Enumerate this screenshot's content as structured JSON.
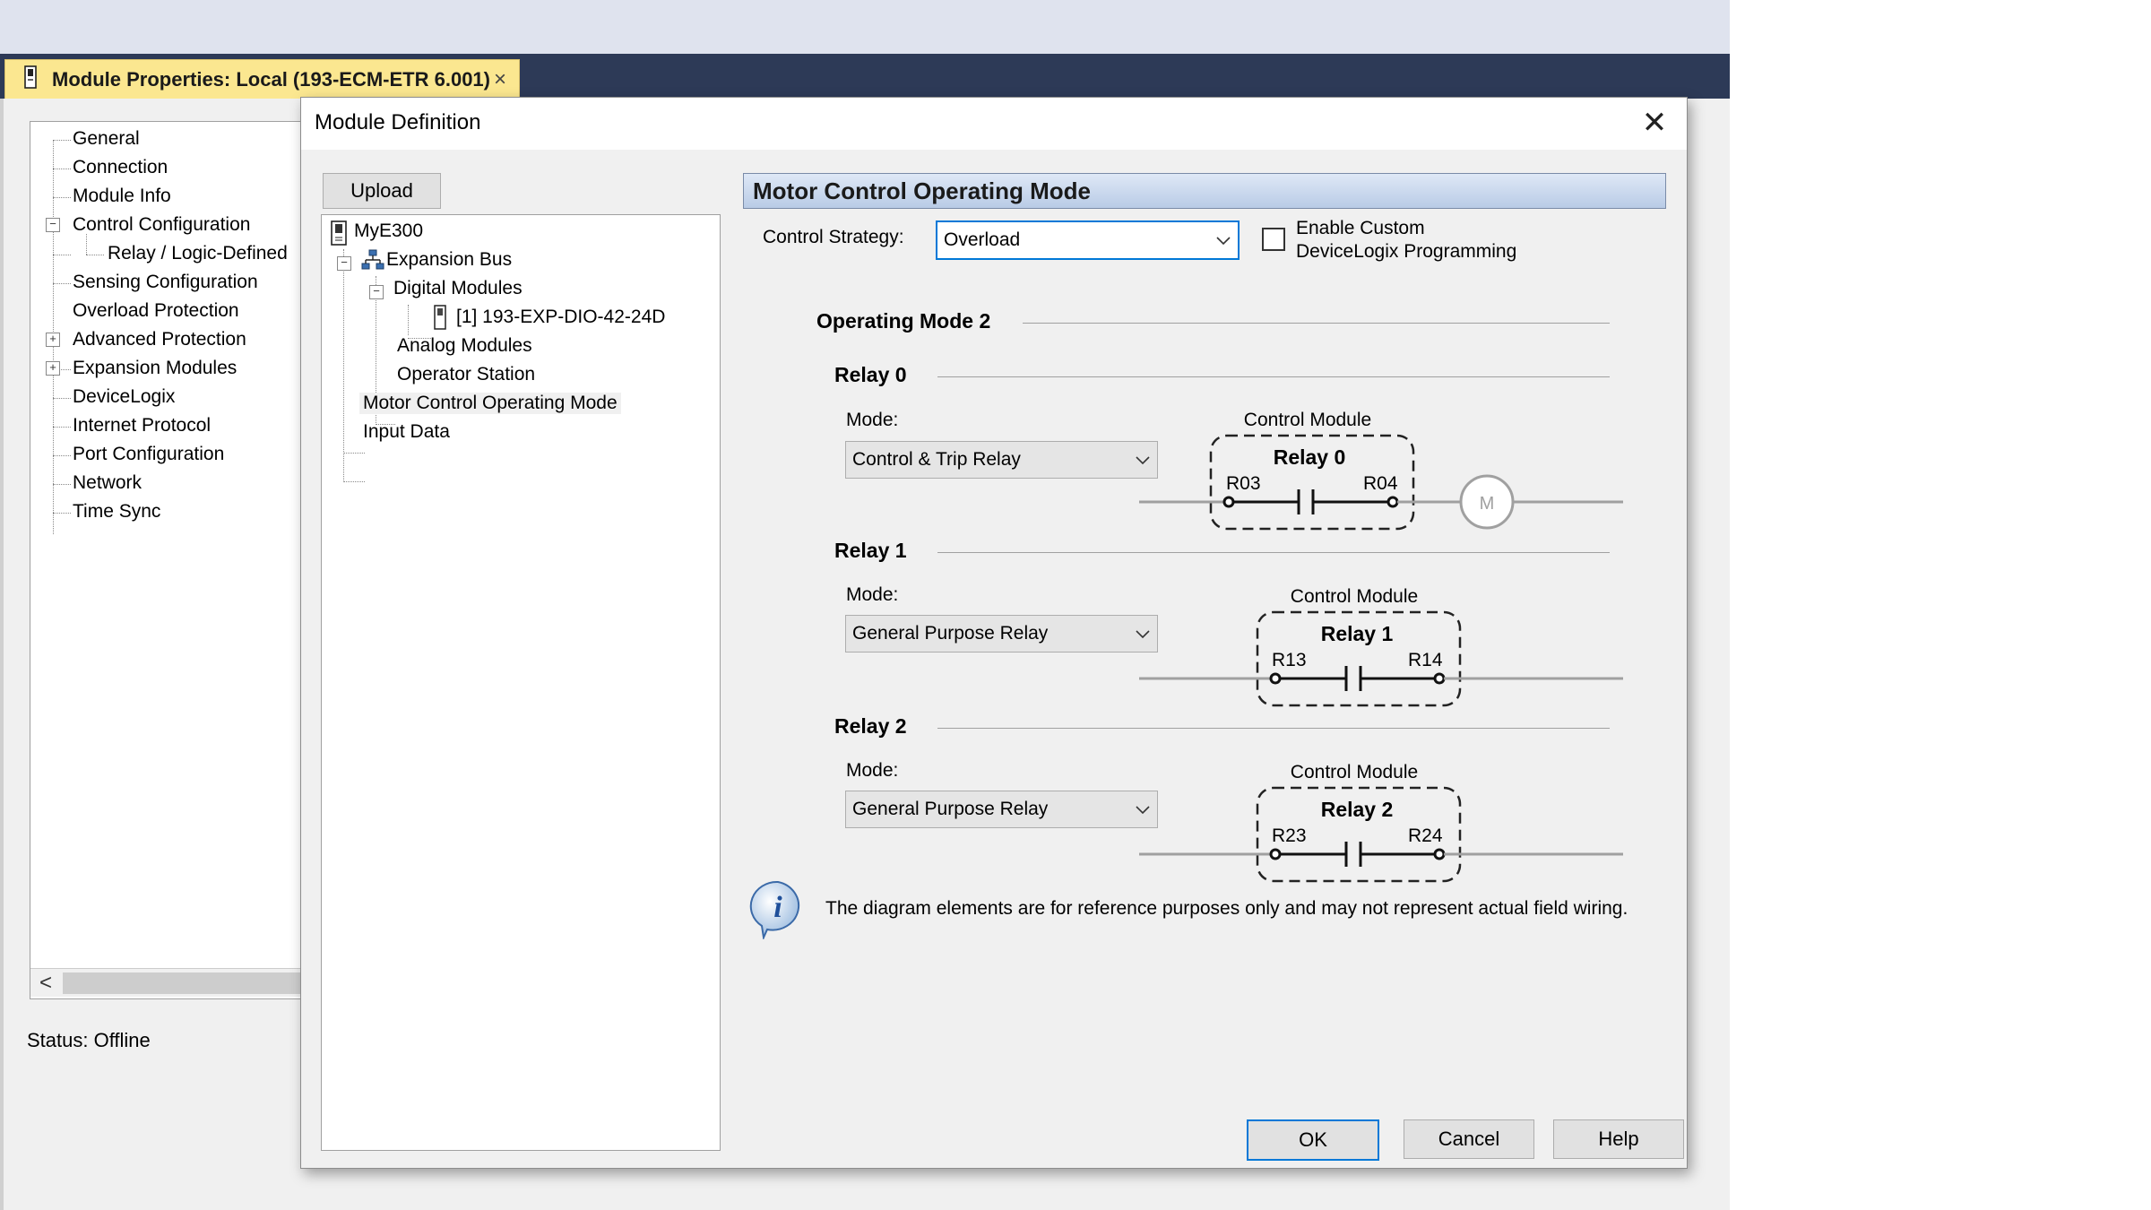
{
  "document_tab": {
    "title": "Module Properties: Local (193-ECM-ETR 6.001)",
    "close_glyph": "×"
  },
  "background_tree": {
    "items": [
      "General",
      "Connection",
      "Module Info",
      "Control Configuration",
      "Relay / Logic-Defined",
      "Sensing Configuration",
      "Overload Protection",
      "Advanced Protection",
      "Expansion Modules",
      "DeviceLogix",
      "Internet Protocol",
      "Port Configuration",
      "Network",
      "Time Sync"
    ],
    "expander_minus": "−",
    "expander_plus": "+",
    "scroll_left": "<"
  },
  "status": {
    "text": "Status:  Offline"
  },
  "dialog": {
    "title": "Module Definition",
    "close_glyph": "✕",
    "upload_label": "Upload",
    "tree": {
      "root": "MyE300",
      "expansion_bus": "Expansion Bus",
      "digital_modules": "Digital Modules",
      "digital_item": "[1] 193-EXP-DIO-42-24D",
      "analog_modules": "Analog Modules",
      "operator_station": "Operator Station",
      "motor_control": "Motor Control Operating Mode",
      "input_data": "Input Data",
      "collapse_glyph": "−"
    },
    "panel": {
      "header": "Motor Control Operating Mode",
      "control_strategy_label": "Control Strategy:",
      "control_strategy_value": "Overload",
      "enable_custom_line1": "Enable Custom",
      "enable_custom_line2": "DeviceLogix Programming",
      "enable_custom_checked": false,
      "operating_mode_title": "Operating Mode 2",
      "relays": [
        {
          "title": "Relay 0",
          "mode_label": "Mode:",
          "mode_value": "Control & Trip Relay",
          "module_label": "Control Module",
          "box_title": "Relay 0",
          "left_terminal": "R03",
          "right_terminal": "R04",
          "motor_label": "M"
        },
        {
          "title": "Relay 1",
          "mode_label": "Mode:",
          "mode_value": "General Purpose Relay",
          "module_label": "Control Module",
          "box_title": "Relay 1",
          "left_terminal": "R13",
          "right_terminal": "R14"
        },
        {
          "title": "Relay 2",
          "mode_label": "Mode:",
          "mode_value": "General Purpose Relay",
          "module_label": "Control Module",
          "box_title": "Relay 2",
          "left_terminal": "R23",
          "right_terminal": "R24"
        }
      ],
      "info_icon_glyph": "i",
      "info_text": "The diagram elements are for reference purposes only and may not represent actual field wiring."
    },
    "buttons": {
      "ok": "OK",
      "cancel": "Cancel",
      "help": "Help"
    }
  },
  "colors": {
    "tab_bar": "#2d3a57",
    "tab_active": "#fbe790",
    "header_gradient_top": "#dfe8f6",
    "header_gradient_bottom": "#b9cbe6",
    "focus_blue": "#0078d7"
  }
}
